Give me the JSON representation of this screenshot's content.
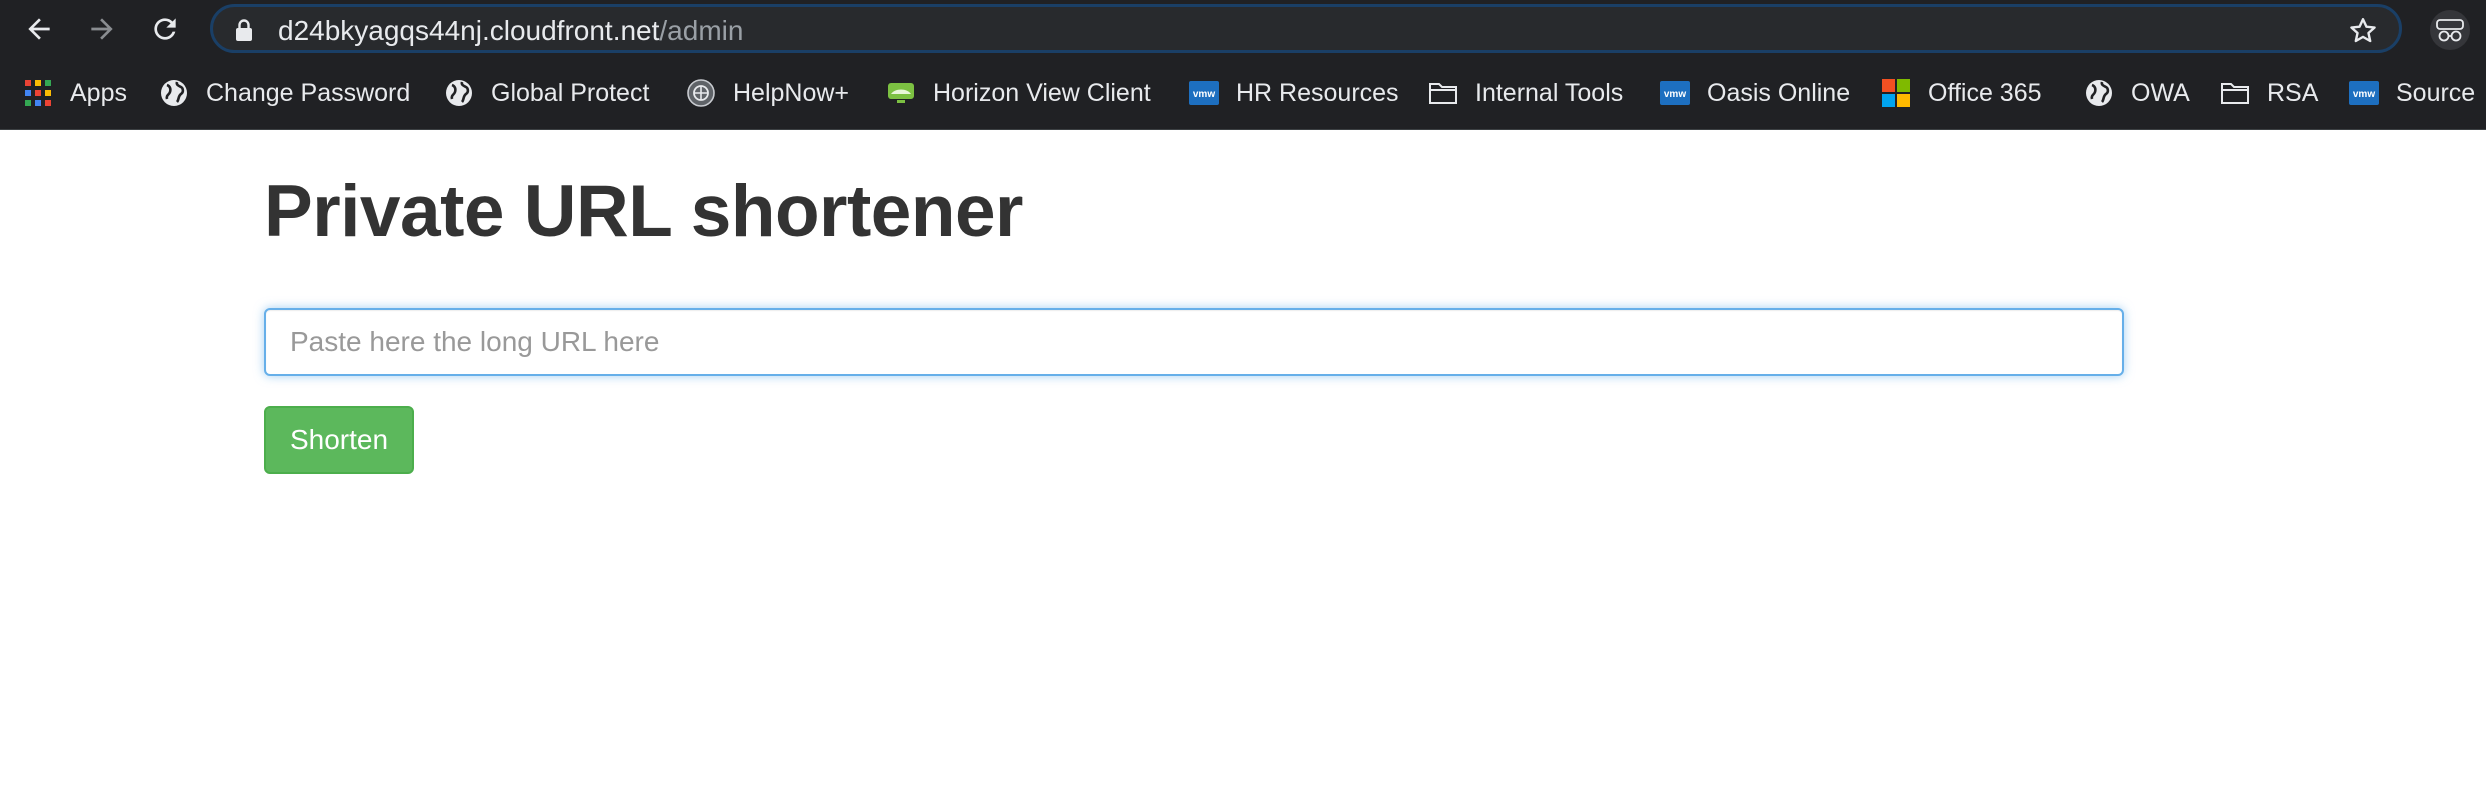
{
  "browser": {
    "url_host": "d24bkyagqs44nj.cloudfront.net",
    "url_path": "/admin",
    "bookmarks": [
      {
        "label": "Apps",
        "icon": "apps-grid-icon"
      },
      {
        "label": "Change Password",
        "icon": "globe-icon"
      },
      {
        "label": "Global Protect",
        "icon": "globe-icon"
      },
      {
        "label": "HelpNow+",
        "icon": "helpnow-icon"
      },
      {
        "label": "Horizon View Client",
        "icon": "horizon-icon"
      },
      {
        "label": "HR Resources",
        "icon": "vmw-icon"
      },
      {
        "label": "Internal Tools",
        "icon": "folder-icon"
      },
      {
        "label": "Oasis Online",
        "icon": "vmw-icon"
      },
      {
        "label": "Office 365",
        "icon": "microsoft-icon"
      },
      {
        "label": "OWA",
        "icon": "globe-icon"
      },
      {
        "label": "RSA",
        "icon": "folder-icon"
      },
      {
        "label": "Source",
        "icon": "vmw-icon"
      }
    ]
  },
  "page": {
    "title": "Private URL shortener",
    "input_placeholder": "Paste here the long URL here",
    "input_value": "",
    "shorten_label": "Shorten"
  },
  "colors": {
    "chrome_bg": "#202124",
    "focus_border": "#66afe9",
    "button_green": "#5cb85c",
    "title_text": "#333333"
  }
}
